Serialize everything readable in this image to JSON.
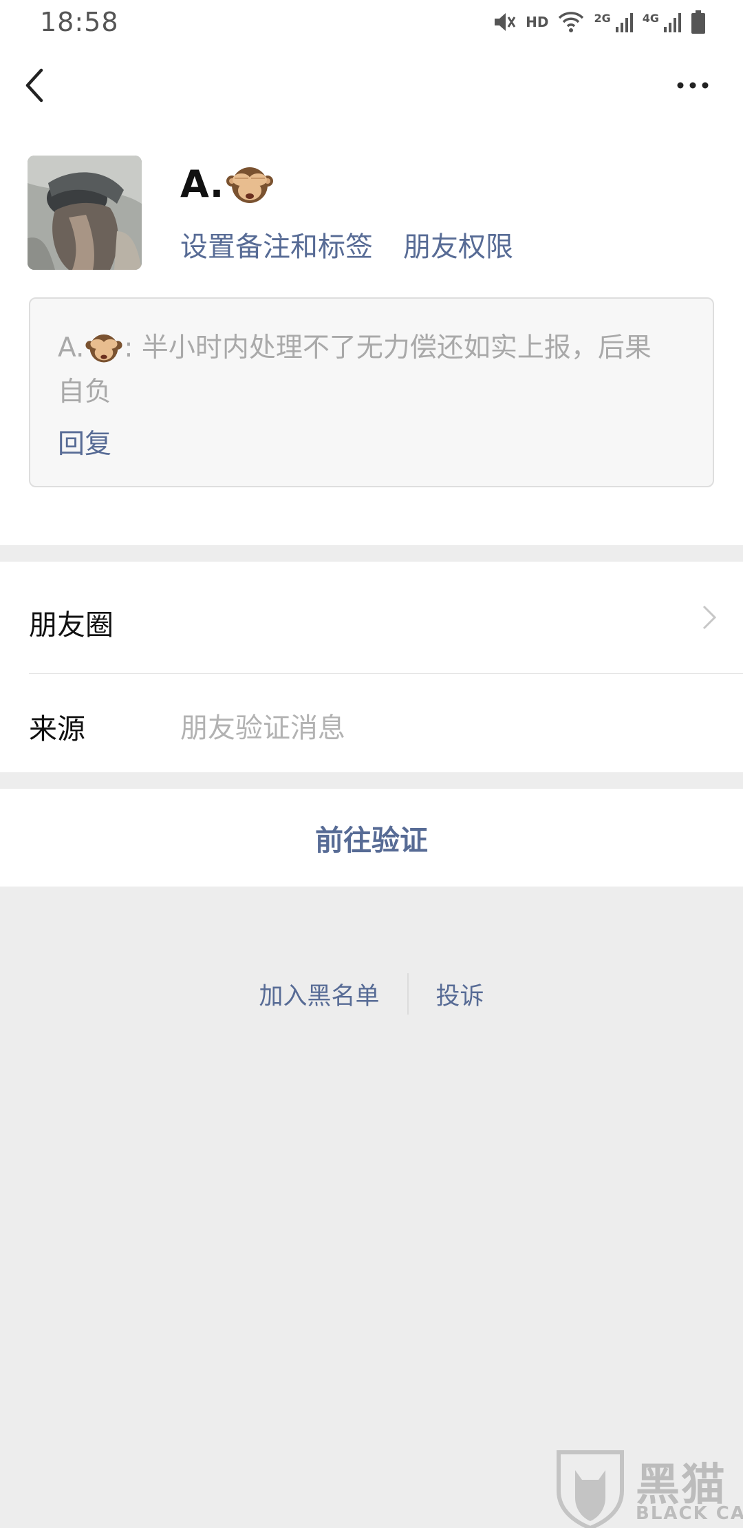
{
  "status_bar": {
    "time": "18:58",
    "hd": "HD",
    "net_2g": "2G",
    "net_4g": "4G",
    "icons": [
      "mute-icon",
      "wifi-icon",
      "signal-icon",
      "signal-icon",
      "battery-icon"
    ]
  },
  "nav": {
    "back_icon": "chevron-left-icon",
    "more_icon": "more-dots-icon"
  },
  "profile": {
    "name": "A.",
    "name_emoji": "see-no-evil-monkey",
    "set_remark_label": "设置备注和标签",
    "permissions_label": "朋友权限"
  },
  "message": {
    "sender": "A.",
    "text_after_emoji": ": 半小时内处理不了无力偿还如实上报，后果自负",
    "reply_label": "回复"
  },
  "rows": {
    "moments_label": "朋友圈",
    "source_label": "来源",
    "source_value": "朋友验证消息"
  },
  "actions": {
    "verify_label": "前往验证",
    "blacklist_label": "加入黑名单",
    "complaint_label": "投诉"
  },
  "watermark": {
    "cn": "黑猫",
    "en": "BLACK CAT"
  },
  "colors": {
    "link": "#576b95",
    "background": "#ededed"
  }
}
